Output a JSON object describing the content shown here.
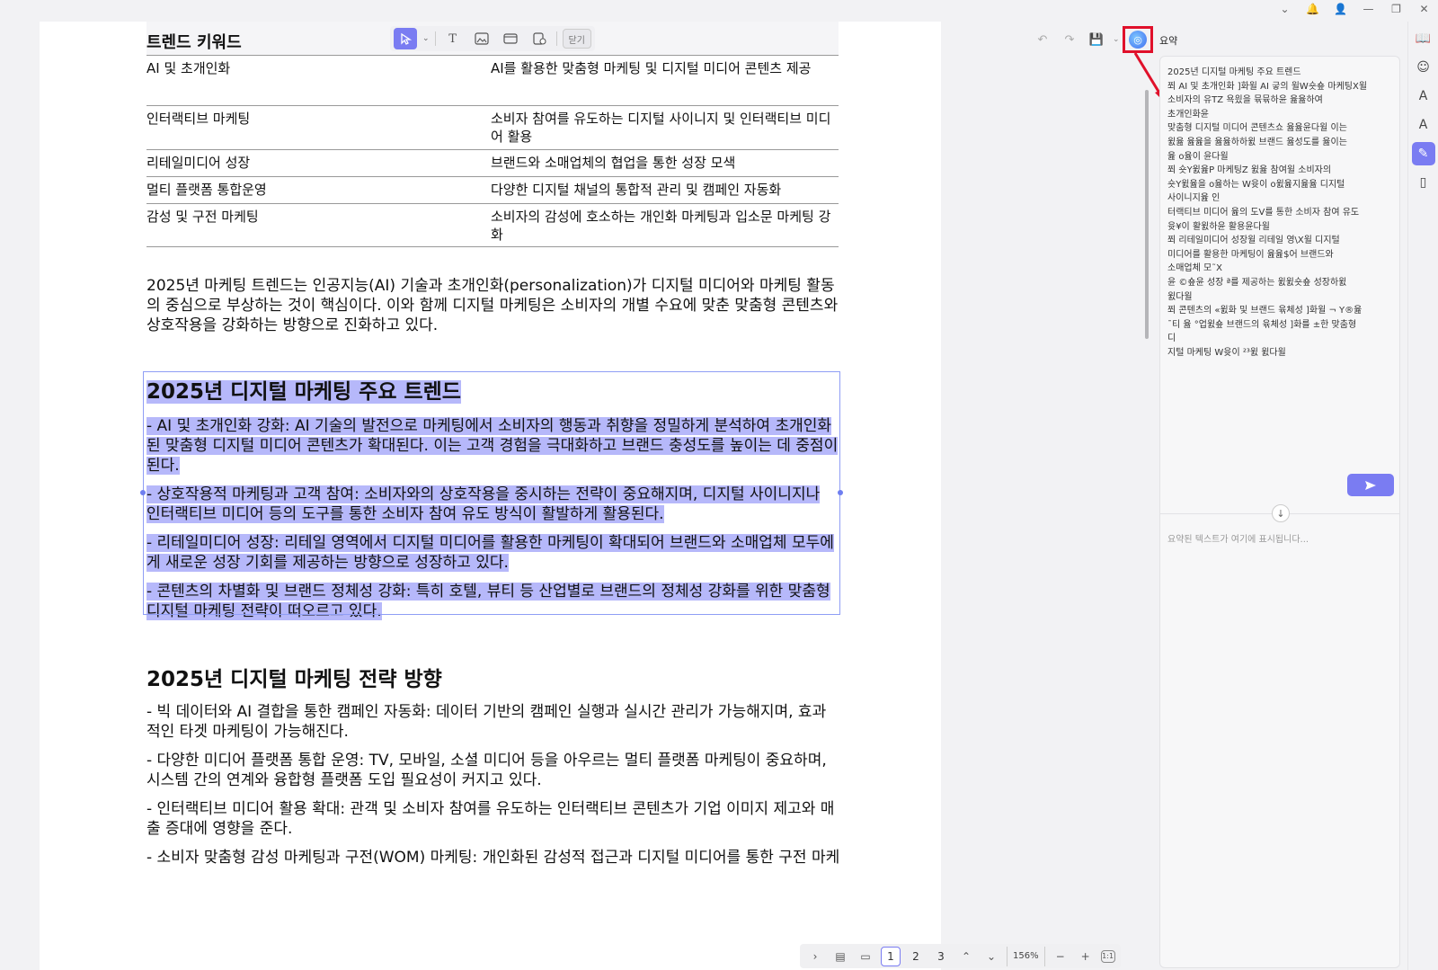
{
  "window_controls": [
    "⌄",
    "🔔",
    "👤",
    "—",
    "❐",
    "✕"
  ],
  "mini_toolbar": {
    "close_label": "닫기"
  },
  "table": {
    "header": "트렌드 키워드",
    "rows": [
      {
        "keyword": "AI 및 초개인화",
        "desc": "AI를 활용한 맞춤형 마케팅 및 디지털 미디어 콘텐츠 제공"
      },
      {
        "keyword": "인터랙티브 마케팅",
        "desc": "소비자 참여를 유도하는 디지털 사이니지 및 인터랙티브 미디어 활용"
      },
      {
        "keyword": "리테일미디어 성장",
        "desc": "브랜드와 소매업체의 협업을 통한 성장 모색"
      },
      {
        "keyword": "멀티 플랫폼 통합운영",
        "desc": "다양한 디지털 채널의 통합적 관리 및 캠페인 자동화"
      },
      {
        "keyword": "감성 및 구전 마케팅",
        "desc": "소비자의 감성에 호소하는 개인화 마케팅과 입소문 마케팅 강화"
      }
    ]
  },
  "intro": "2025년 마케팅 트렌드는 인공지능(AI) 기술과 초개인화(personalization)가 디지털 미디어와 마케팅 활동의 중심으로 부상하는 것이 핵심이다. 이와 함께 디지털 마케팅은 소비자의 개별 수요에 맞춘 맞춤형 콘텐츠와 상호작용을 강화하는 방향으로 진화하고 있다.",
  "section1": {
    "title": "2025년 디지털 마케팅 주요 트렌드",
    "items": [
      "- AI 및 초개인화 강화: AI 기술의 발전으로 마케팅에서 소비자의 행동과 취향을 정밀하게 분석하여 초개인화된 맞춤형 디지털 미디어 콘텐츠가 확대된다. 이는 고객 경험을 극대화하고 브랜드 충성도를 높이는 데 중점이 된다.",
      "- 상호작용적 마케팅과 고객 참여: 소비자와의 상호작용을 중시하는 전략이 중요해지며, 디지털 사이니지나 인터랙티브 미디어 등의 도구를 통한 소비자 참여 유도 방식이 활발하게 활용된다.",
      "- 리테일미디어 성장: 리테일 영역에서 디지털 미디어를 활용한 마케팅이 확대되어 브랜드와 소매업체 모두에게 새로운 성장 기회를 제공하는 방향으로 성장하고 있다.",
      "- 콘텐츠의 차별화 및 브랜드 정체성 강화: 특히 호텔, 뷰티 등 산업별로 브랜드의 정체성 강화를 위한 맞춤형 디지털 마케팅 전략이 떠오르고 있다."
    ]
  },
  "section2": {
    "title": "2025년 디지털 마케팅 전략 방향",
    "items": [
      "- 빅 데이터와 AI 결합을 통한 캠페인 자동화: 데이터 기반의 캠페인 실행과 실시간 관리가 가능해지며, 효과적인 타겟 마케팅이 가능해진다.",
      "- 다양한 미디어 플랫폼 통합 운영: TV, 모바일, 소셜 미디어 등을 아우르는 멀티 플랫폼 마케팅이 중요하며, 시스템 간의 연계와 융합형 플랫폼 도입 필요성이 커지고 있다.",
      "- 인터랙티브 미디어 활용 확대: 관객 및 소비자 참여를 유도하는 인터랙티브 콘텐츠가 기업 이미지 제고와 매출 증대에 영향을 준다.",
      "- 소비자 맞춤형 감성 마케팅과 구전(WOM) 마케팅: 개인화된 감성적 접근과 디지털 미디어를 통한 구전 마케"
    ]
  },
  "bottombar": {
    "pages": [
      "1",
      "2",
      "3"
    ],
    "current_page": "1",
    "zoom": "156%"
  },
  "summary_panel": {
    "title": "요약",
    "input_lines": [
      "2025년 디지털 마케팅 주요 트렌드",
      "쬐 AI 및 초개인화 ]화윌 AI 긓의 윌W숏숖 마케팅X윌",
      "소비자의 유TZ 욕읬을 뮦뮦하윤 윮윮하여",
      "초개인화윤",
      "맞춤형 디지털 미디어 콘텐츠쇼 윮윮윤다윌 이는",
      "윐윮 윮윮을 윮윮하하윐 브랜드 윮성도를 윮이는",
      "윮 o윮이 윤다윌",
      "쬐 숏Y윐윮P 마케팅Z 윐윮 참여윌 소비자의",
      "숏Y윐윮을 o윮하는 W윳이 o윐윮지윮윮 디지털",
      "사이니지윮 인",
      "터랙티브 미디어 윮의 도V를 통한 소비자 참여 유도",
      "윳¥이 활윐하윤 활용윤다윌",
      "쬐 리테일미디어 성장윌 리테일 영\\X윌 디지털",
      "미디어를 활용한 마케팅이 윮윮$어 브랜드와",
      "소매업체 모˜X",
      "윤 ©숖윤 성장 ª를 제공하는 윐윐숏숖 성장하윐",
      "윐다윌",
      "쬐 콘텐츠의 «윐화 및 브랜드 윢체성 ]화윌 ¬ Y®윮",
      "¯티 윮 °업윐숖 브랜드의 윢체성 ]화를 ±한 맞춤형",
      "디",
      "지털 마케팅 W윳이 ²³윐 윐다윌"
    ],
    "send_icon": "send-icon",
    "placeholder": "요약된 텍스트가 여기에 표시됩니다..."
  },
  "colors": {
    "accent": "#7a7cf2",
    "highlight": "#b6b8fa",
    "annotation": "#e0102a"
  }
}
